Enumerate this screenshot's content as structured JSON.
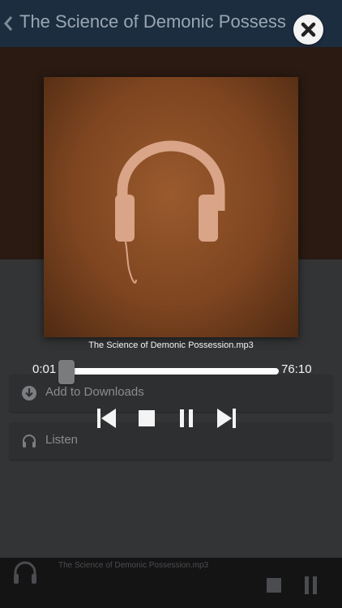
{
  "header": {
    "title": "The Science of Demonic Possession",
    "back_icon": "chevron-left-icon"
  },
  "background_list": {
    "faded_label": "",
    "rows": [
      {
        "icon": "download-circle-icon",
        "label": "Add to Downloads"
      },
      {
        "icon": "headphones-icon",
        "label": "Listen"
      }
    ]
  },
  "mini_player": {
    "title": "The Science of Demonic Possession.mp3",
    "icon": "headphones-icon"
  },
  "player": {
    "close_icon": "close-icon",
    "artwork_icon": "headphones-icon",
    "track_name": "The Science of Demonic Possession.mp3",
    "elapsed": "0:01",
    "total": "76:10",
    "progress_fraction": 0.0002,
    "controls": [
      "skip-previous-icon",
      "stop-icon",
      "pause-icon",
      "skip-next-icon"
    ]
  },
  "colors": {
    "header_bg": "#1c2d3f",
    "artwork_brown": "#7e4520",
    "headphones_tint": "#d9a487"
  }
}
